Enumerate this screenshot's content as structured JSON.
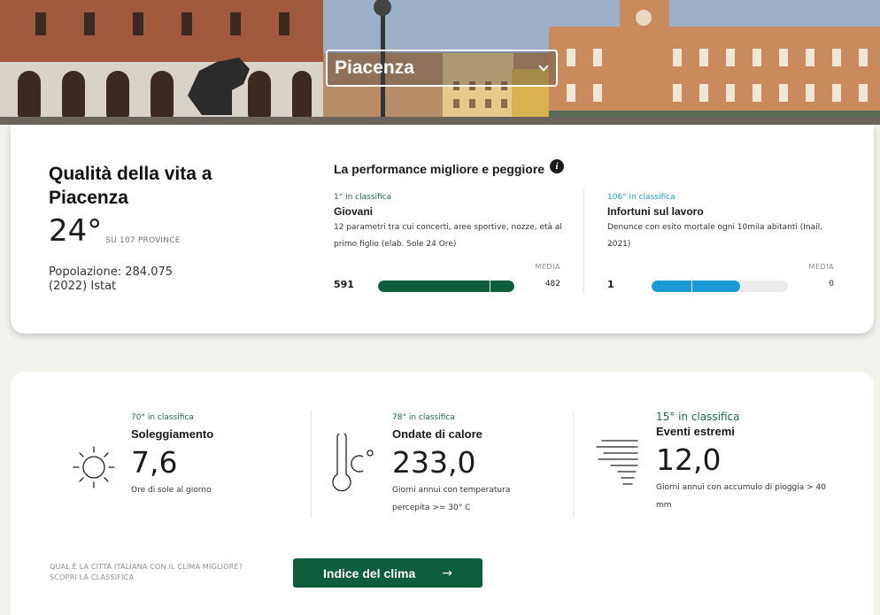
{
  "hero": {
    "city": "Piacenza"
  },
  "quality": {
    "title": "Qualità della vita a Piacenza",
    "rank": "24°",
    "rank_sub": "SU 107 PROVINCE",
    "population": "Popolazione: 284.075 (2022) Istat"
  },
  "performance": {
    "heading": "La performance migliore e peggiore",
    "best": {
      "classifica": "1° in classifica",
      "name": "Giovani",
      "desc": "12 parametri tra cui concerti, aree sportive, nozze, età al primo figlio (elab. Sole 24 Ore)",
      "media_label": "MEDIA",
      "value": "591",
      "avg": "482",
      "fill": 1.0,
      "avg_pos": 0.816,
      "color": "#0c5e3c",
      "label_color": "#1d6b45"
    },
    "worst": {
      "classifica": "106° in classifica",
      "name": "Infortuni sul lavoro",
      "desc": "Denunce con esito mortale ogni 10mila abitanti (Inail, 2021)",
      "media_label": "MEDIA",
      "value": "1",
      "avg": "0",
      "fill": 0.65,
      "avg_pos": 0.29,
      "color": "#1b9ad6",
      "label_color": "#1b9ad6"
    }
  },
  "climate": {
    "items": [
      {
        "classifica": "70° in classifica",
        "name": "Soleggiamento",
        "value": "7,6",
        "desc": "Ore di sole al giorno",
        "icon": "sun-icon"
      },
      {
        "classifica": "78° in classifica",
        "name": "Ondate di calore",
        "value": "233,0",
        "desc": "Giorni annui con temperatura percepita >= 30° C",
        "icon": "thermometer-icon"
      },
      {
        "classifica": "15° in classifica",
        "name": "Eventi estremi",
        "value": "12,0",
        "desc": "Giorni annui con accumulo di pioggia > 40 mm",
        "icon": "storm-icon"
      }
    ],
    "prompt_line1": "QUAL È LA CITTÀ ITALIANA CON IL CLIMA MIGLIORE?",
    "prompt_line2": "SCOPRI LA CLASSIFICA",
    "button_label": "Indice del clima",
    "button_arrow": "→"
  }
}
